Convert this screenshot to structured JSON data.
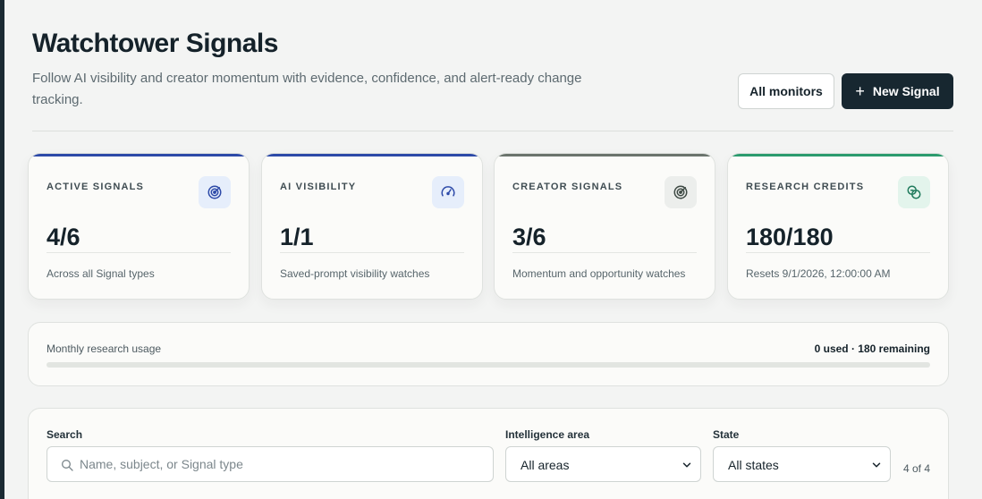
{
  "header": {
    "title": "Watchtower Signals",
    "subtitle": "Follow AI visibility and creator momentum with evidence, confidence, and alert-ready change tracking.",
    "all_monitors_label": "All monitors",
    "new_signal_label": "New Signal",
    "new_signal_icon": "plus-icon"
  },
  "cards": [
    {
      "label": "ACTIVE SIGNALS",
      "value": "4/6",
      "note": "Across all Signal types",
      "icon": "radar-icon",
      "accent": "#2d4aa8",
      "icon_bg": "#e6eefb",
      "icon_color": "#2d4aa8"
    },
    {
      "label": "AI VISIBILITY",
      "value": "1/1",
      "note": "Saved-prompt visibility watches",
      "icon": "gauge-icon",
      "accent": "#2d4aa8",
      "icon_bg": "#e6eefb",
      "icon_color": "#2d4aa8"
    },
    {
      "label": "CREATOR SIGNALS",
      "value": "3/6",
      "note": "Momentum and opportunity watches",
      "icon": "radar-icon",
      "accent": "#6b746d",
      "icon_bg": "#eceeec",
      "icon_color": "#3e4a44"
    },
    {
      "label": "RESEARCH CREDITS",
      "value": "180/180",
      "note": "Resets 9/1/2026, 12:00:00 AM",
      "icon": "coins-icon",
      "accent": "#2c9b6e",
      "icon_bg": "#e3f4ec",
      "icon_color": "#1f7a5c"
    }
  ],
  "usage": {
    "label": "Monthly research usage",
    "stat": "0 used · 180 remaining",
    "used_fraction": 0
  },
  "filters": {
    "search_label": "Search",
    "search_placeholder": "Name, subject, or Signal type",
    "search_value": "",
    "area_label": "Intelligence area",
    "area_selected": "All areas",
    "state_label": "State",
    "state_selected": "All states",
    "count": "4 of 4"
  },
  "colors": {
    "rail": "#1b2a33",
    "primary_button": "#172730",
    "usage_fill": "#1f7a5c"
  }
}
